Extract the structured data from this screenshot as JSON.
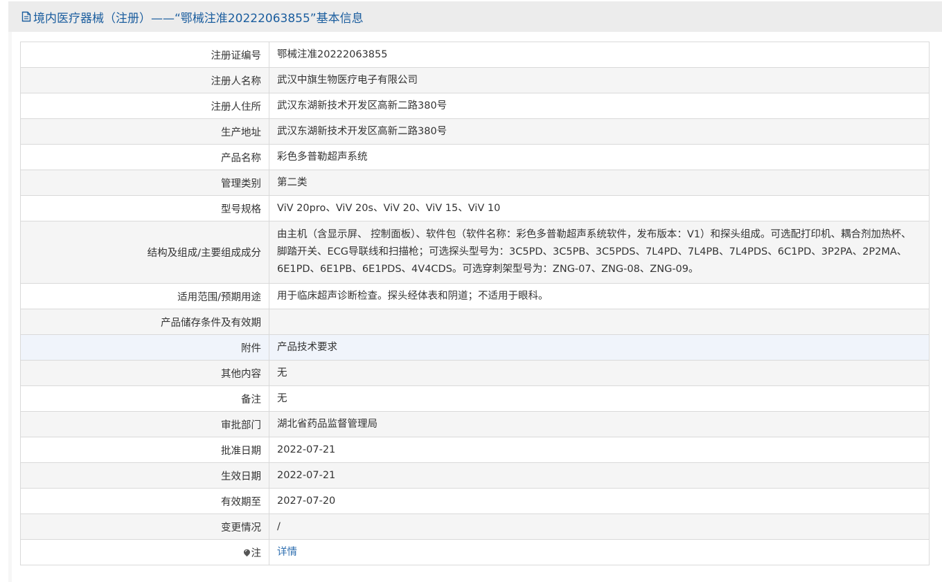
{
  "header": {
    "title": "境内医疗器械（注册）——“鄂械注准20222063855”基本信息",
    "icon": "document-icon"
  },
  "rows": [
    {
      "label": "注册证编号",
      "value": "鄂械注准20222063855"
    },
    {
      "label": "注册人名称",
      "value": "武汉中旗生物医疗电子有限公司"
    },
    {
      "label": "注册人住所",
      "value": "武汉东湖新技术开发区高新二路380号"
    },
    {
      "label": "生产地址",
      "value": "武汉东湖新技术开发区高新二路380号"
    },
    {
      "label": "产品名称",
      "value": "彩色多普勒超声系统"
    },
    {
      "label": "管理类别",
      "value": "第二类"
    },
    {
      "label": "型号规格",
      "value": "ViV 20pro、ViV 20s、ViV 20、ViV 15、ViV 10"
    },
    {
      "label": "结构及组成/主要组成成分",
      "value": "由主机（含显示屏、 控制面板）、软件包（软件名称：彩色多普勒超声系统软件，发布版本：V1）和探头组成。可选配打印机、耦合剂加热杯、脚踏开关、ECG导联线和扫描枪；可选探头型号为：3C5PD、3C5PB、3C5PDS、7L4PD、7L4PB、7L4PDS、6C1PD、3P2PA、2P2MA、6E1PD、6E1PB、6E1PDS、4V4CDS。可选穿刺架型号为：ZNG-07、ZNG-08、ZNG-09。"
    },
    {
      "label": "适用范围/预期用途",
      "value": "用于临床超声诊断检查。探头经体表和阴道；不适用于眼科。"
    },
    {
      "label": "产品储存条件及有效期",
      "value": ""
    },
    {
      "label": "附件",
      "value": "产品技术要求"
    },
    {
      "label": "其他内容",
      "value": "无"
    },
    {
      "label": "备注",
      "value": "无"
    },
    {
      "label": "审批部门",
      "value": "湖北省药品监督管理局"
    },
    {
      "label": "批准日期",
      "value": "2022-07-21"
    },
    {
      "label": "生效日期",
      "value": "2022-07-21"
    },
    {
      "label": "有效期至",
      "value": "2027-07-20"
    },
    {
      "label": "变更情况",
      "value": "/"
    },
    {
      "label": "注",
      "value": "详情",
      "icon": "pin-icon"
    }
  ],
  "colors": {
    "title": "#1a5d9e",
    "link": "#2f6fb0",
    "row_alt": "#f5f5f5",
    "border": "#d9d9d9"
  }
}
